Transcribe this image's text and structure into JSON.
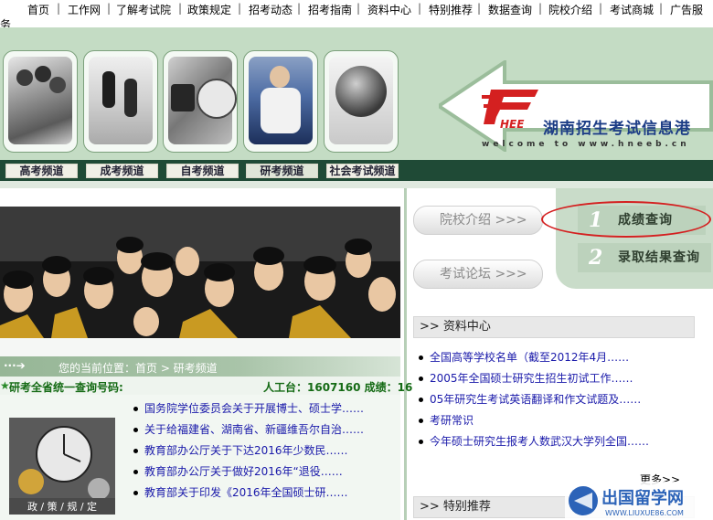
{
  "top_nav": {
    "items": [
      "首页",
      "工作网",
      "了解考试院",
      "政策规定",
      "招考动态",
      "招考指南",
      "资料中心",
      "特别推荐",
      "数据查询",
      "院校介绍",
      "考试商城",
      "广告服"
    ],
    "overflow": "务"
  },
  "header": {
    "logo_mark": "HEE",
    "title": "湖南招生考试信息港",
    "subtitle": "welcome to www.hneeb.cn"
  },
  "channels": [
    "高考频道",
    "成考频道",
    "自考频道",
    "研考频道",
    "社会考试频道"
  ],
  "right": {
    "pill1": "院校介绍 >>>",
    "pill2": "考试论坛 >>>",
    "query1": {
      "num": "1",
      "label": "成绩查询"
    },
    "query2": {
      "num": "2",
      "label": "录取结果查询"
    },
    "ziliao": {
      "title": ">> 资料中心",
      "items": [
        "全国高等学校名单（截至2012年4月……",
        "2005年全国硕士研究生招生初试工作……",
        "05年研究生考试英语翻译和作文试题及……",
        "考研常识",
        "今年硕士研究生报考人数武汉大学列全国……"
      ],
      "more": "更多>>"
    },
    "tebie": {
      "title": ">> 特别推荐"
    }
  },
  "breadcrumb": "您的当前位置：首页 > 研考频道",
  "infobar": {
    "label": "研考全省统一查询号码:",
    "service": "人工台：1607160  成绩：16"
  },
  "news": [
    "国务院学位委员会关于开展博士、硕士学……",
    "关于给福建省、湖南省、新疆维吾尔自治……",
    "教育部办公厅关于下达2016年少数民……",
    "教育部办公厅关于做好2016年“退役……",
    "教育部关于印发《2016年全国硕士研……"
  ],
  "policy_caption": "政 / 策 / 规 / 定",
  "watermark": {
    "main": "出国留学网",
    "sub": "WWW.LIUXUE86.COM"
  },
  "colors": {
    "brand_red": "#d42020",
    "brand_blue": "#1d3d86",
    "dark_green": "#1f4a36",
    "link_blue": "#1a1aaa"
  }
}
